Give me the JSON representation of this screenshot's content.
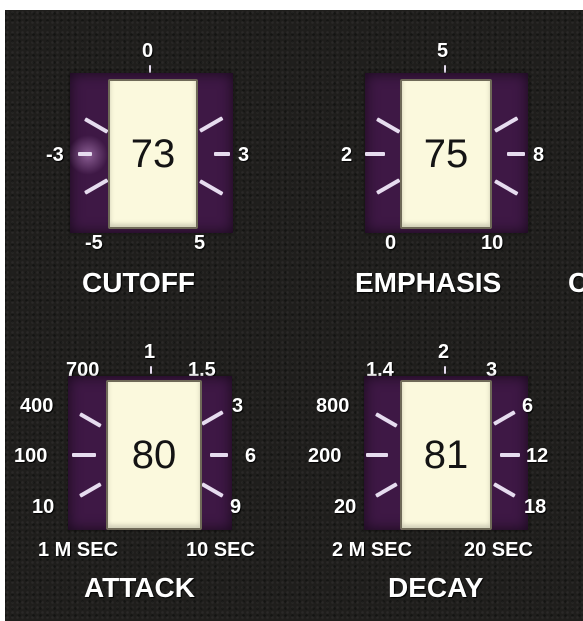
{
  "knobs": {
    "cutoff": {
      "value": "73",
      "name": "CUTOFF",
      "scale": {
        "top": "0",
        "left": "-3",
        "right": "3",
        "bottom_left": "-5",
        "bottom_right": "5"
      }
    },
    "emphasis": {
      "value": "75",
      "name": "EMPHASIS",
      "scale": {
        "top": "5",
        "left": "2",
        "right": "8",
        "bottom_left": "0",
        "bottom_right": "10"
      }
    },
    "attack": {
      "value": "80",
      "name": "ATTACK",
      "scale": {
        "top": "1",
        "top_left": "700",
        "top_right": "1.5",
        "left_upper": "400",
        "left": "100",
        "left_lower": "10",
        "right_upper": "3",
        "right": "6",
        "right_lower": "9"
      },
      "unit_left": "1 M SEC",
      "unit_right": "10 SEC"
    },
    "decay": {
      "value": "81",
      "name": "DECAY",
      "scale": {
        "top": "2",
        "top_left": "1.4",
        "top_right": "3",
        "left_upper": "800",
        "left": "200",
        "left_lower": "20",
        "right_upper": "6",
        "right": "12",
        "right_lower": "18"
      },
      "unit_left": "2 M SEC",
      "unit_right": "20 SEC"
    }
  },
  "partial_label_right_edge": "C"
}
